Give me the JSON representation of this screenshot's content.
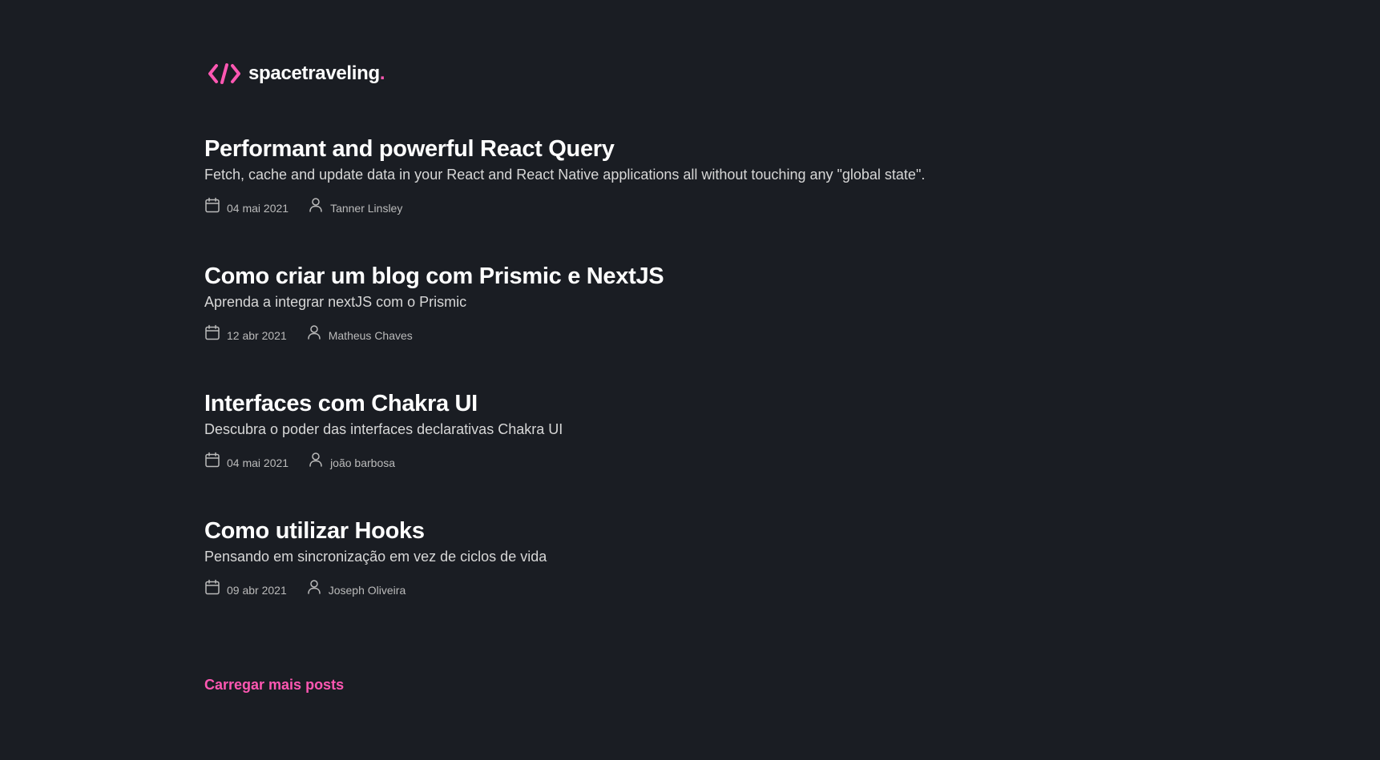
{
  "header": {
    "logo_text": "spacetraveling",
    "logo_dot": ".",
    "logo_icon": "code-brackets-icon",
    "accent_color": "#ff57b2"
  },
  "posts": [
    {
      "title": "Performant and powerful React Query",
      "subtitle": "Fetch, cache and update data in your React and React Native applications all without touching any \"global state\".",
      "date": "04 mai 2021",
      "author": "Tanner Linsley"
    },
    {
      "title": "Como criar um blog com Prismic e NextJS",
      "subtitle": "Aprenda a integrar nextJS com o Prismic",
      "date": "12 abr 2021",
      "author": "Matheus Chaves"
    },
    {
      "title": "Interfaces com Chakra UI",
      "subtitle": "Descubra o poder das interfaces declarativas Chakra UI",
      "date": "04 mai 2021",
      "author": "joão barbosa"
    },
    {
      "title": "Como utilizar Hooks",
      "subtitle": "Pensando em sincronização em vez de ciclos de vida",
      "date": "09 abr 2021",
      "author": "Joseph Oliveira"
    }
  ],
  "load_more_label": "Carregar mais posts",
  "icons": {
    "date": "calendar-icon",
    "author": "user-icon"
  },
  "colors": {
    "background": "#1a1d23",
    "title": "#ffffff",
    "subtitle": "#d7d7d7",
    "meta": "#bbbbbb",
    "accent": "#ff57b2"
  }
}
